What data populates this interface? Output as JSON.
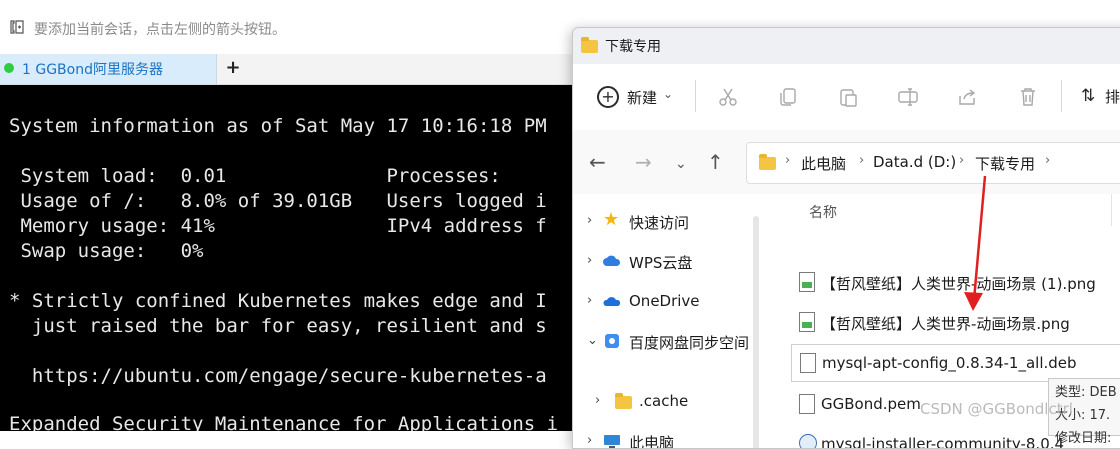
{
  "terminal_app": {
    "hint_text": "要添加当前会话，点击左侧的箭头按钮。",
    "tab_label": "1 GGBond阿里服务器",
    "add_tab": "+",
    "lines": [
      "System information as of Sat May 17 10:16:18 PM",
      "",
      " System load:  0.01              Processes:",
      " Usage of /:   8.0% of 39.01GB   Users logged i",
      " Memory usage: 41%               IPv4 address f",
      " Swap usage:   0%",
      "",
      "* Strictly confined Kubernetes makes edge and I",
      "  just raised the bar for easy, resilient and s",
      "",
      "  https://ubuntu.com/engage/secure-kubernetes-a",
      "",
      "Expanded Security Maintenance for Applications i"
    ]
  },
  "explorer": {
    "title": "下载专用",
    "toolbar": {
      "new_label": "新建",
      "sort_label": "排"
    },
    "address": {
      "parts": [
        "此电脑",
        "Data.d (D:)",
        "下载专用"
      ]
    },
    "nav": [
      {
        "label": "快速访问",
        "icon": "star-icon"
      },
      {
        "label": "WPS云盘",
        "icon": "cloud-icon"
      },
      {
        "label": "OneDrive",
        "icon": "onedrive-icon"
      },
      {
        "label": "百度网盘同步空间",
        "icon": "baidu-icon"
      },
      {
        "label": ".cache",
        "icon": "folder-icon"
      },
      {
        "label": "此电脑",
        "icon": "pc-icon"
      }
    ],
    "column_name": "名称",
    "files": [
      {
        "name": "【哲风壁纸】人类世界-动画场景 (1).png",
        "type": "image"
      },
      {
        "name": "【哲风壁纸】人类世界-动画场景.png",
        "type": "image"
      },
      {
        "name": "mysql-apt-config_0.8.34-1_all.deb",
        "type": "file"
      },
      {
        "name": "GGBond.pem",
        "type": "file"
      },
      {
        "name": "mysql-installer-community-8.0.4",
        "type": "package"
      }
    ],
    "tooltip": {
      "line1": "类型: DEB",
      "line2": "大小: 17.",
      "line3": "修改日期:"
    }
  },
  "watermark": "CSDN @GGBondlctrl",
  "colors": {
    "terminal_bg": "#000000",
    "tab_active_bg": "#d9ecfb",
    "status_green": "#2ecc40",
    "arrow_red": "#e02020"
  }
}
